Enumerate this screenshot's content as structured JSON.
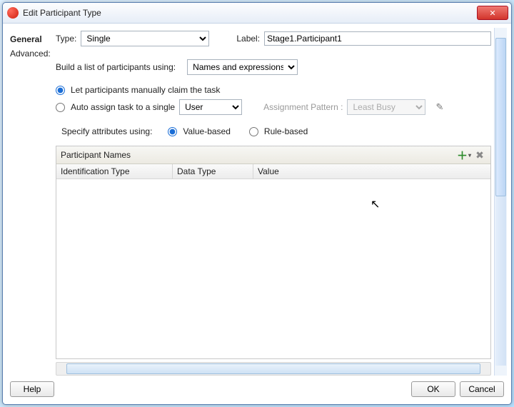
{
  "window": {
    "title": "Edit Participant Type"
  },
  "sidebar": {
    "tabs": [
      {
        "label": "General",
        "active": true
      },
      {
        "label": "Advanced:",
        "active": false
      }
    ]
  },
  "form": {
    "type_label": "Type:",
    "type_value": "Single",
    "label_label": "Label:",
    "label_value": "Stage1.Participant1",
    "build_list_label": "Build a list of participants using:",
    "build_list_value": "Names and expressions",
    "manual_claim_label": "Let participants manually claim the task",
    "auto_assign_label": "Auto assign task to a single",
    "auto_assign_target": "User",
    "assignment_pattern_label": "Assignment Pattern :",
    "assignment_pattern_value": "Least Busy",
    "specify_attributes_label": "Specify attributes using:",
    "value_based_label": "Value-based",
    "rule_based_label": "Rule-based"
  },
  "table": {
    "title": "Participant Names",
    "columns": [
      "Identification Type",
      "Data Type",
      "Value"
    ],
    "rows": []
  },
  "buttons": {
    "help": "Help",
    "ok": "OK",
    "cancel": "Cancel"
  }
}
